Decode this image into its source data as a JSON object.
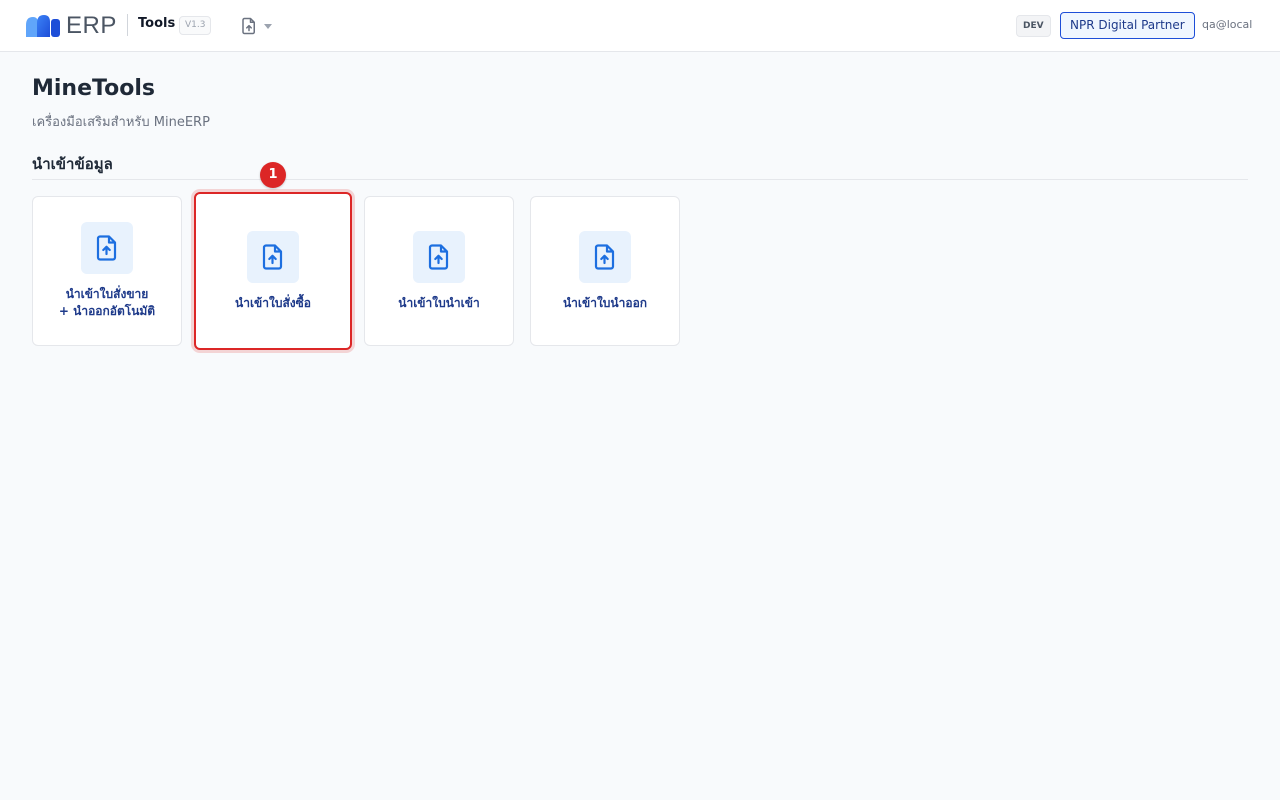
{
  "header": {
    "logo_text": "ERP",
    "app_name": "Tools",
    "version": "V1.3",
    "menu_icon": "file-upload-icon",
    "env_badge": "DEV",
    "org_name": "NPR Digital Partner",
    "user": "qa@local"
  },
  "page": {
    "title": "MineTools",
    "subtitle": "เครื่องมือเสริมสำหรับ MineERP"
  },
  "section": {
    "title": "นำเข้าข้อมูล"
  },
  "cards": [
    {
      "label": "นำเข้าใบสั่งขาย\n+ นำออกอัตโนมัติ",
      "icon": "file-upload-icon"
    },
    {
      "label": "นำเข้าใบสั่งซื้อ",
      "icon": "file-upload-icon"
    },
    {
      "label": "นำเข้าใบนำเข้า",
      "icon": "file-upload-icon"
    },
    {
      "label": "นำเข้าใบนำออก",
      "icon": "file-upload-icon"
    }
  ],
  "annotation": {
    "step_number": "1"
  },
  "colors": {
    "brand_blue": "#1d6fe0",
    "card_label": "#1e3a8a",
    "highlight_red": "#dc2626",
    "icon_bg": "#e8f2fd"
  }
}
